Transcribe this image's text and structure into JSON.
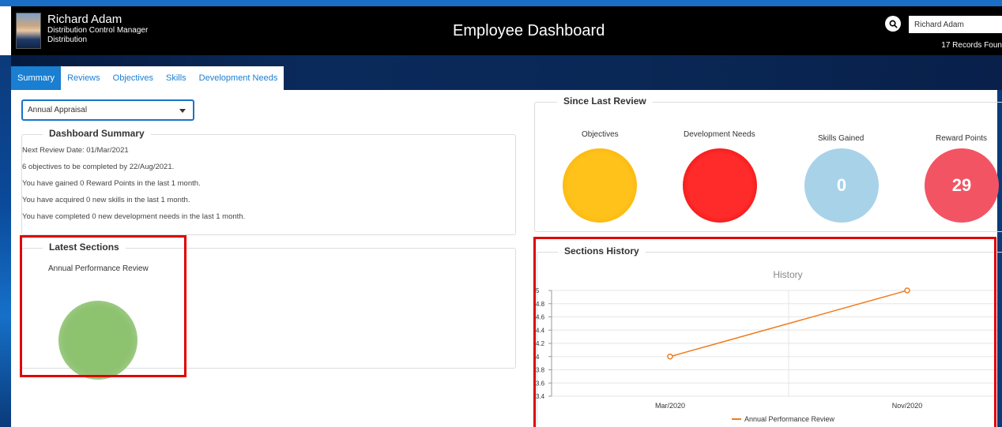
{
  "header": {
    "user_name": "Richard Adam",
    "user_role": "Distribution Control Manager",
    "user_dept": "Distribution",
    "title": "Employee Dashboard",
    "search_value": "Richard Adam",
    "records_text": "17 Records Foun"
  },
  "tabs": [
    {
      "label": "Summary",
      "active": true
    },
    {
      "label": "Reviews"
    },
    {
      "label": "Objectives"
    },
    {
      "label": "Skills"
    },
    {
      "label": "Development Needs"
    }
  ],
  "appraisal_select": {
    "value": "Annual Appraisal"
  },
  "dashboard_summary": {
    "title": "Dashboard Summary",
    "lines": [
      "Next Review Date: 01/Mar/2021",
      "6 objectives to be completed by 22/Aug/2021.",
      "You have gained 0 Reward Points in the last 1 month.",
      "You have acquired 0 new skills in the last 1 month.",
      "You have completed 0 new development needs in the last 1 month."
    ]
  },
  "latest_sections": {
    "title": "Latest Sections",
    "item_label": "Annual Performance Review",
    "item_color": "#8dc26f"
  },
  "since_last_review": {
    "title": "Since Last Review",
    "items": [
      {
        "label": "Objectives",
        "value": "",
        "color": "#ffc21a"
      },
      {
        "label": "Development Needs",
        "value": "",
        "color": "#ff2a2a"
      },
      {
        "label": "Skills Gained",
        "value": "0",
        "color": "#a8d2e8"
      },
      {
        "label": "Reward Points",
        "value": "29",
        "color": "#f25463"
      }
    ]
  },
  "sections_history": {
    "title": "Sections History"
  },
  "chart_data": {
    "type": "line",
    "title": "History",
    "categories": [
      "Mar/2020",
      "Nov/2020"
    ],
    "series": [
      {
        "name": "Annual Performance Review",
        "values": [
          4,
          5
        ],
        "color": "#f07d1e"
      }
    ],
    "ylim": [
      3.4,
      5
    ],
    "yticks": [
      "3.4",
      "3.6",
      "3.8",
      "4",
      "4.2",
      "4.4",
      "4.6",
      "4.8",
      "5"
    ],
    "grid": true,
    "legend": "bottom"
  }
}
